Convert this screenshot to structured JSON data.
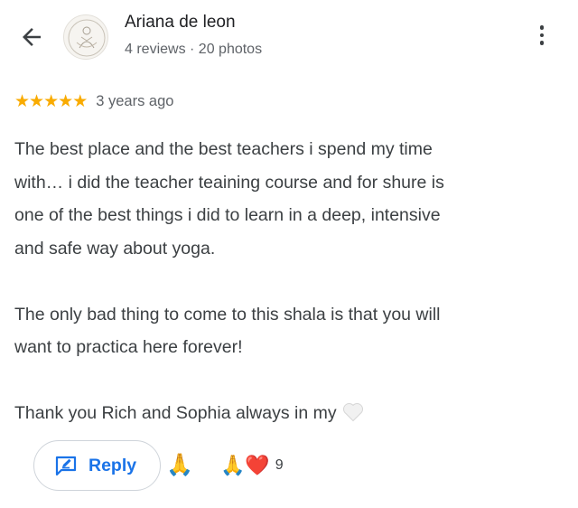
{
  "reviewer": {
    "name": "Ariana de leon",
    "meta": "4 reviews · 20 photos"
  },
  "rating": {
    "stars": 5,
    "max_stars": 5,
    "time_ago": "3 years ago"
  },
  "review": {
    "paragraph1": "The best place and the best teachers i spend my time with… i did the teacher teaining course and for shure is one of the best things i did to learn in a deep, intensive and safe way about yoga.",
    "paragraph1_lines": [
      "The best place and the best teachers i spend my time",
      "with… i did the teacher teaining course and for shure is",
      "one of the best things i did to learn in a deep, intensive",
      "and safe way about yoga."
    ],
    "paragraph2_lines": [
      "The only bad thing to come to this shala is that you will",
      "want to practica here forever!"
    ],
    "paragraph3": "Thank you Rich and Sophia always in my",
    "paragraph3_emoji": "white-heart"
  },
  "actions": {
    "reply_label": "Reply",
    "react_emoji": "🙏",
    "reaction_emojis": "🙏❤️",
    "reaction_count": "9"
  },
  "colors": {
    "star": "#f9ab00",
    "reply_accent": "#1a73e8",
    "text": "#3c4043",
    "secondary": "#5f6368"
  },
  "icons": [
    "back-arrow-icon",
    "avatar-logo-icon",
    "more-vert-icon",
    "star-icon",
    "reply-icon",
    "white-heart-icon"
  ]
}
